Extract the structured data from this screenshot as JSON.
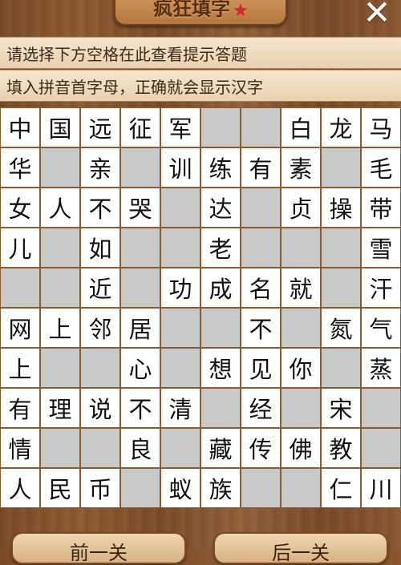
{
  "header": {
    "title": "疯狂填字",
    "close_label": "✕"
  },
  "hints": {
    "line1": "请选择下方空格在此查看提示答题",
    "line2": "填入拼音首字母，正确就会显示汉字"
  },
  "grid": {
    "rows": [
      [
        "中",
        "国",
        "远",
        "征",
        "军",
        "",
        "",
        "白",
        "龙",
        "马"
      ],
      [
        "华",
        "",
        "亲",
        "",
        "训",
        "练",
        "有",
        "素",
        "",
        "毛"
      ],
      [
        "女",
        "人",
        "不",
        "哭",
        "",
        "达",
        "",
        "贞",
        "操",
        "带"
      ],
      [
        "儿",
        "",
        "如",
        "",
        "",
        "老",
        "",
        "",
        "",
        "雪"
      ],
      [
        "",
        "",
        "近",
        "",
        "功",
        "成",
        "名",
        "就",
        "",
        "汗"
      ],
      [
        "网",
        "上",
        "邻",
        "居",
        "",
        "",
        "不",
        "",
        "氮",
        "气"
      ],
      [
        "上",
        "",
        "",
        "心",
        "",
        "想",
        "见",
        "你",
        "",
        "蒸"
      ],
      [
        "有",
        "理",
        "说",
        "不",
        "清",
        "",
        "经",
        "",
        "宋",
        ""
      ],
      [
        "情",
        "",
        "",
        "良",
        "",
        "藏",
        "传",
        "佛",
        "教",
        ""
      ],
      [
        "人",
        "民",
        "币",
        "",
        "蚁",
        "族",
        "",
        "",
        "仁",
        "川"
      ]
    ]
  },
  "footer": {
    "prev_label": "前一关",
    "next_label": "后一关"
  },
  "colors": {
    "empty_cell": "#c9c9c9",
    "filled_cell": "#ffffff",
    "wood": "#8a5731"
  }
}
